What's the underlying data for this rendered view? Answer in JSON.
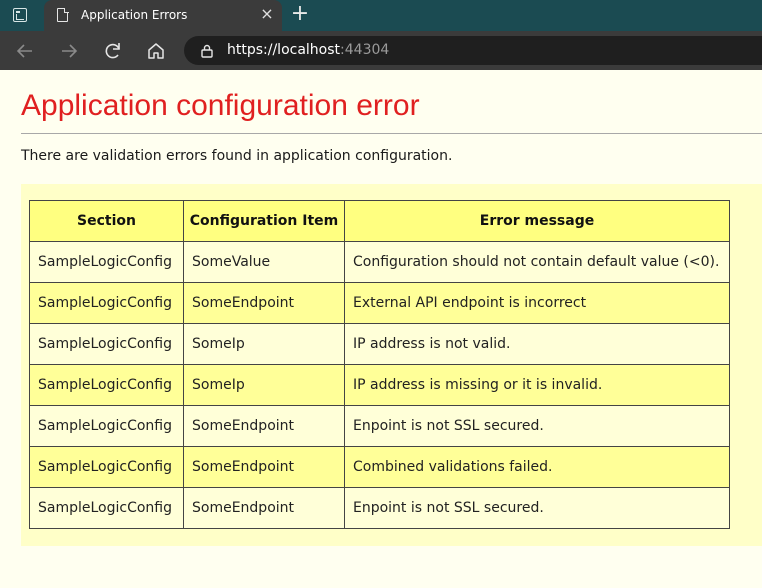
{
  "browser": {
    "tab_title": "Application Errors",
    "close_glyph": "×",
    "new_tab_glyph": "+",
    "url_scheme_host": "https://localhost",
    "url_port": ":44304"
  },
  "page": {
    "heading": "Application configuration error",
    "intro": "There are validation errors found in application configuration.",
    "heading_color": "#e02020"
  },
  "table": {
    "headers": [
      "Section",
      "Configuration Item",
      "Error message"
    ],
    "rows": [
      [
        "SampleLogicConfig",
        "SomeValue",
        "Configuration should not contain default value (<0)."
      ],
      [
        "SampleLogicConfig",
        "SomeEndpoint",
        "External API endpoint is incorrect"
      ],
      [
        "SampleLogicConfig",
        "SomeIp",
        "IP address is not valid."
      ],
      [
        "SampleLogicConfig",
        "SomeIp",
        "IP address is missing or it is invalid."
      ],
      [
        "SampleLogicConfig",
        "SomeEndpoint",
        "Enpoint is not SSL secured."
      ],
      [
        "SampleLogicConfig",
        "SomeEndpoint",
        "Combined validations failed."
      ],
      [
        "SampleLogicConfig",
        "SomeEndpoint",
        "Enpoint is not SSL secured."
      ]
    ]
  }
}
